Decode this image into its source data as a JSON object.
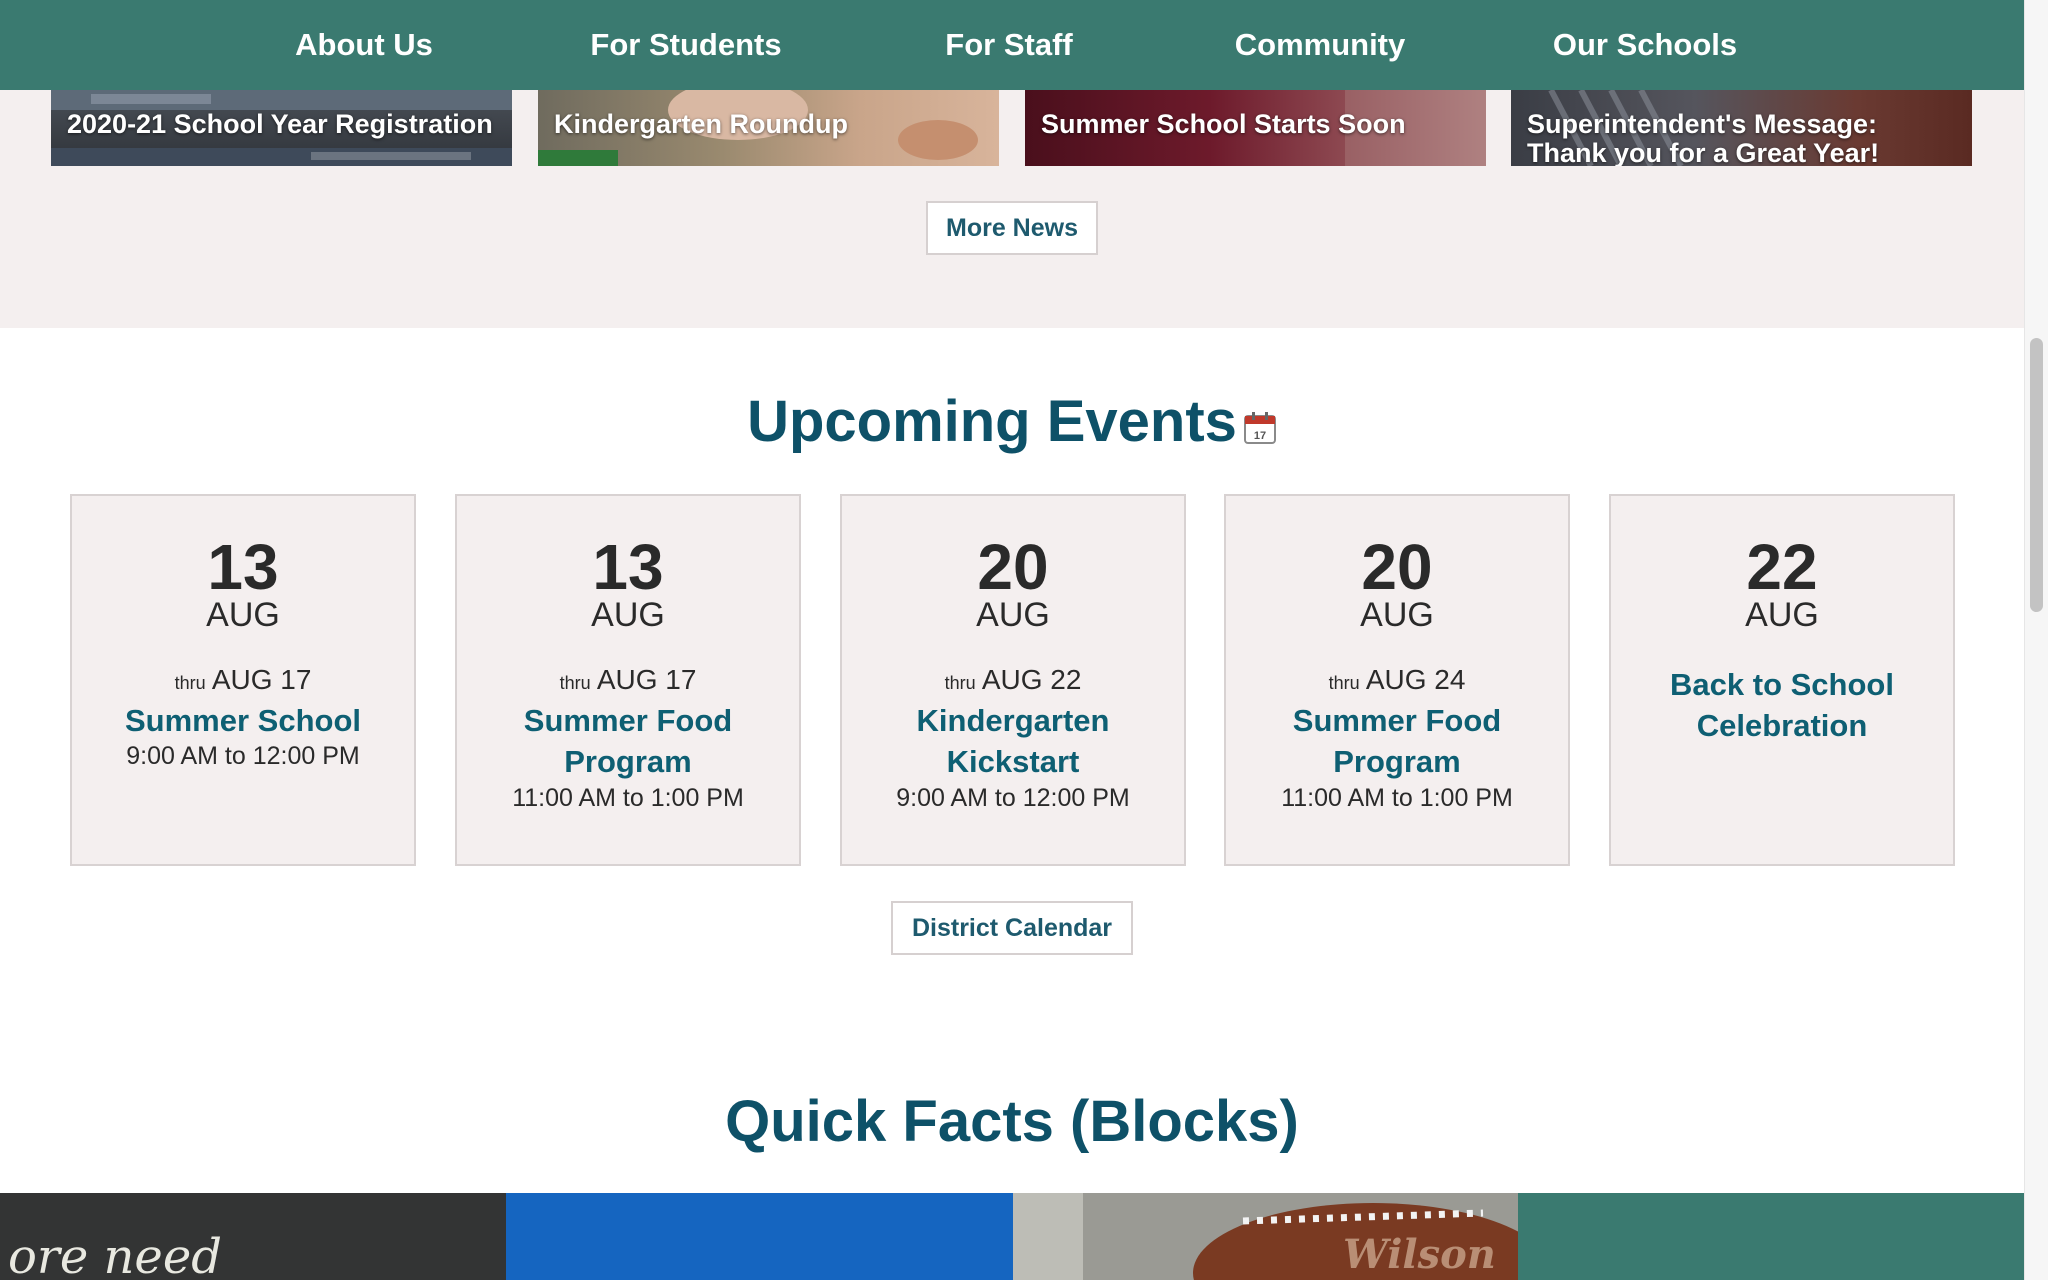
{
  "nav": {
    "items": [
      {
        "label": "About Us"
      },
      {
        "label": "For Students"
      },
      {
        "label": "For Staff"
      },
      {
        "label": "Community"
      },
      {
        "label": "Our Schools"
      }
    ]
  },
  "news": {
    "cards": [
      {
        "title": "2020-21 School Year Registration"
      },
      {
        "title": "Kindergarten Roundup"
      },
      {
        "title": "Summer School Starts Soon"
      },
      {
        "title": "Superintendent's Message: Thank you for a Great Year!"
      }
    ],
    "more_label": "More News"
  },
  "events": {
    "heading": "Upcoming Events",
    "thru_label": "thru",
    "items": [
      {
        "day": "13",
        "month": "AUG",
        "thru": "AUG 17",
        "title": "Summer School",
        "time": "9:00 AM to 12:00 PM"
      },
      {
        "day": "13",
        "month": "AUG",
        "thru": "AUG 17",
        "title": "Summer Food Program",
        "time": "11:00 AM to 1:00 PM"
      },
      {
        "day": "20",
        "month": "AUG",
        "thru": "AUG 22",
        "title": "Kindergarten Kickstart",
        "time": "9:00 AM to 12:00 PM"
      },
      {
        "day": "20",
        "month": "AUG",
        "thru": "AUG 24",
        "title": "Summer Food Program",
        "time": "11:00 AM to 1:00 PM"
      },
      {
        "day": "22",
        "month": "AUG",
        "thru": "",
        "title": "Back to School Celebration",
        "time": ""
      }
    ],
    "calendar_label": "District Calendar",
    "calendar_icon_text": "17"
  },
  "facts": {
    "heading": "Quick Facts (Blocks)",
    "chalk_text": "ore need",
    "football_text": "Wilson"
  },
  "colors": {
    "nav_bg": "#3a7a70",
    "heading": "#0e5168",
    "link": "#0e5f73",
    "band_bg": "#f4efef",
    "block_blue": "#1565c0",
    "block_teal": "#3a7a70"
  }
}
